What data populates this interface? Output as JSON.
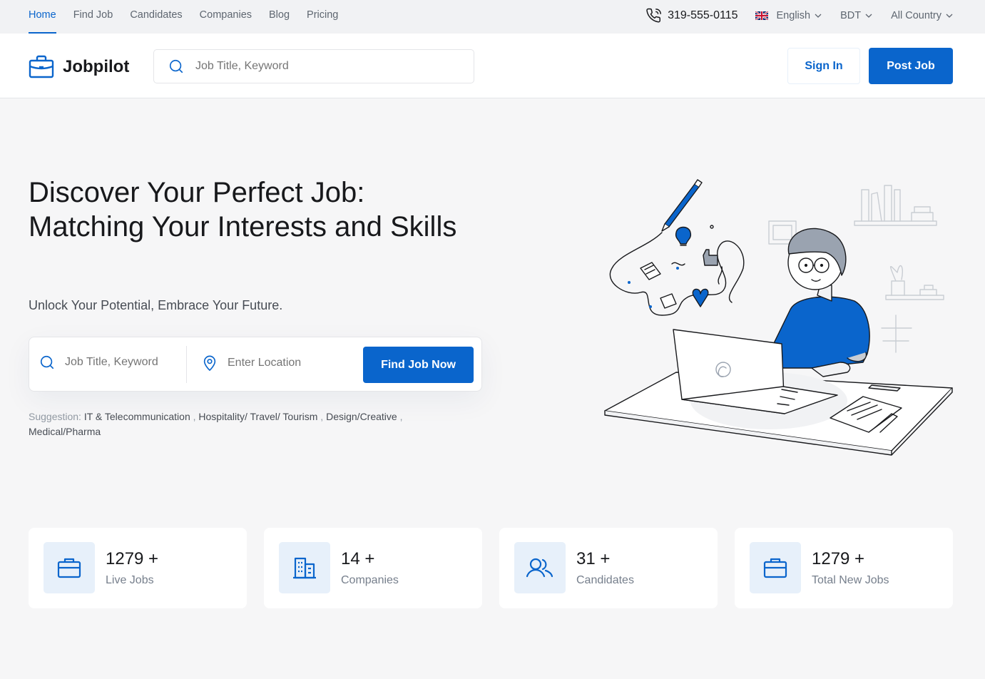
{
  "topbar": {
    "nav": [
      "Home",
      "Find Job",
      "Candidates",
      "Companies",
      "Blog",
      "Pricing"
    ],
    "active": "Home",
    "phone": "319-555-0115",
    "language": "English",
    "currency": "BDT",
    "country": "All Country"
  },
  "header": {
    "logo": "Jobpilot",
    "search_placeholder": "Job Title, Keyword",
    "sign_in": "Sign In",
    "post_job": "Post Job"
  },
  "hero": {
    "title": "Discover Your Perfect Job: Matching Your Interests and Skills",
    "subtitle": "Unlock Your Potential, Embrace Your Future.",
    "keyword_placeholder": "Job Title, Keyword",
    "location_placeholder": "Enter Location",
    "find_button": "Find Job Now",
    "suggestion_label": "Suggestion:",
    "suggestions": [
      "IT & Telecommunication",
      "Hospitality/ Travel/ Tourism",
      "Design/Creative",
      "Medical/Pharma"
    ]
  },
  "stats": [
    {
      "number": "1279 +",
      "label": "Live Jobs",
      "icon": "briefcase-icon"
    },
    {
      "number": "14 +",
      "label": "Companies",
      "icon": "building-icon"
    },
    {
      "number": "31 +",
      "label": "Candidates",
      "icon": "users-icon"
    },
    {
      "number": "1279 +",
      "label": "Total New Jobs",
      "icon": "briefcase-icon"
    }
  ],
  "colors": {
    "primary": "#0a65cc",
    "primary_light": "#e7f0fa",
    "background": "#f6f6f7"
  }
}
